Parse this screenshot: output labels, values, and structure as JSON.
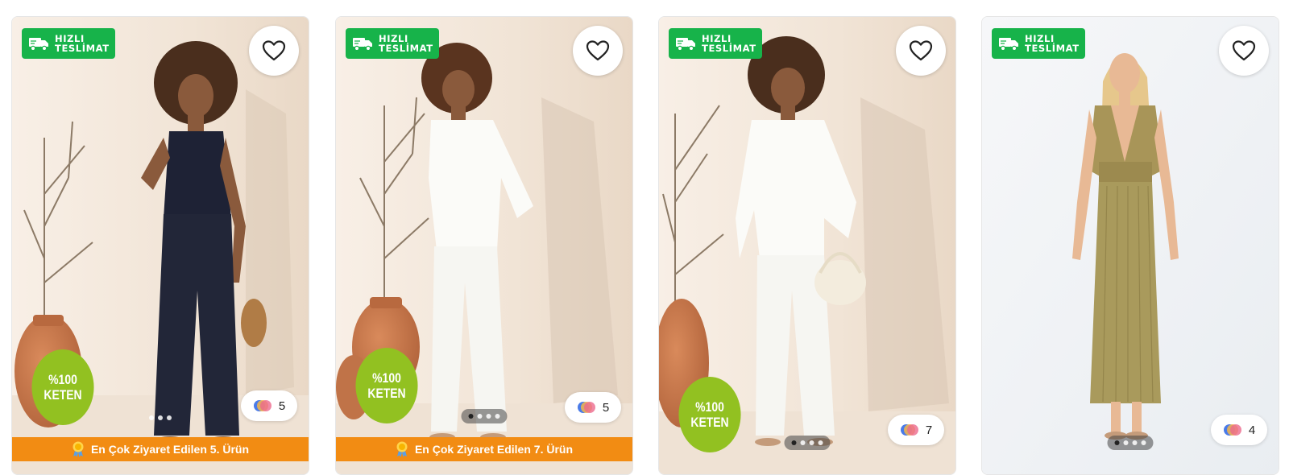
{
  "products": [
    {
      "badge_line1": "HIZLI",
      "badge_line2": "TESLİMAT",
      "linen_line1": "%100",
      "linen_line2": "KETEN",
      "color_count": "5",
      "rank_text": "En Çok Ziyaret Edilen 5. Ürün",
      "outfit": "navy linen vest and trousers"
    },
    {
      "badge_line1": "HIZLI",
      "badge_line2": "TESLİMAT",
      "linen_line1": "%100",
      "linen_line2": "KETEN",
      "color_count": "5",
      "rank_text": "En Çok Ziyaret Edilen 7. Ürün",
      "outfit": "white linen shirt and trousers"
    },
    {
      "badge_line1": "HIZLI",
      "badge_line2": "TESLİMAT",
      "linen_line1": "%100",
      "linen_line2": "KETEN",
      "color_count": "7",
      "outfit": "white linen shirt and trousers with bag"
    },
    {
      "badge_line1": "HIZLI",
      "badge_line2": "TESLİMAT",
      "color_count": "4",
      "outfit": "olive halter maxi dress"
    }
  ],
  "colors": {
    "fast_delivery": "#17b34a",
    "linen_badge": "#92c121",
    "rank_bar": "#f28c13"
  },
  "icons": {
    "delivery": "truck-icon",
    "favorite": "heart-icon",
    "colors": "color-swatch-icon",
    "rank": "medal-icon"
  }
}
